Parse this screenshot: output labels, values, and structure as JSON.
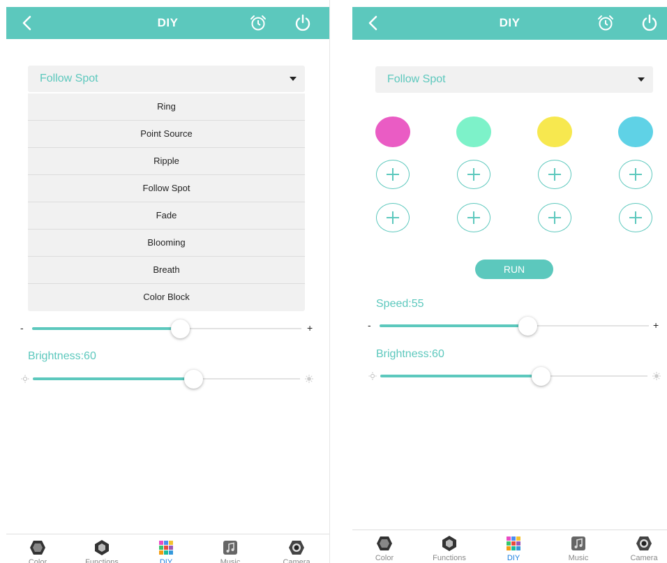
{
  "left": {
    "header": {
      "title": "DIY"
    },
    "dropdown": {
      "value": "Follow Spot"
    },
    "menu": [
      "Ring",
      "Point Source",
      "Ripple",
      "Follow Spot",
      "Fade",
      "Blooming",
      "Breath",
      "Color Block"
    ],
    "speed": {
      "value": 55,
      "minus": "-",
      "plus": "+"
    },
    "brightness": {
      "label": "Brightness:60",
      "value": 60
    }
  },
  "right": {
    "header": {
      "title": "DIY"
    },
    "dropdown": {
      "value": "Follow Spot"
    },
    "colors": [
      "#ea5cc4",
      "#7df2c9",
      "#f7e84f",
      "#5fd2e6"
    ],
    "run_label": "RUN",
    "speed": {
      "label": "Speed:55",
      "value": 55,
      "minus": "-",
      "plus": "+"
    },
    "brightness": {
      "label": "Brightness:60",
      "value": 60
    }
  },
  "tabs": [
    {
      "label": "Color",
      "icon": "color-hexagon-icon"
    },
    {
      "label": "Functions",
      "icon": "functions-hexagon-icon"
    },
    {
      "label": "DIY",
      "icon": "diy-cube-icon",
      "active": true
    },
    {
      "label": "Music",
      "icon": "music-note-icon"
    },
    {
      "label": "Camera",
      "icon": "camera-lens-icon"
    }
  ],
  "colors": {
    "accent": "#5cc8bd",
    "active_tab": "#1a7fe0"
  }
}
